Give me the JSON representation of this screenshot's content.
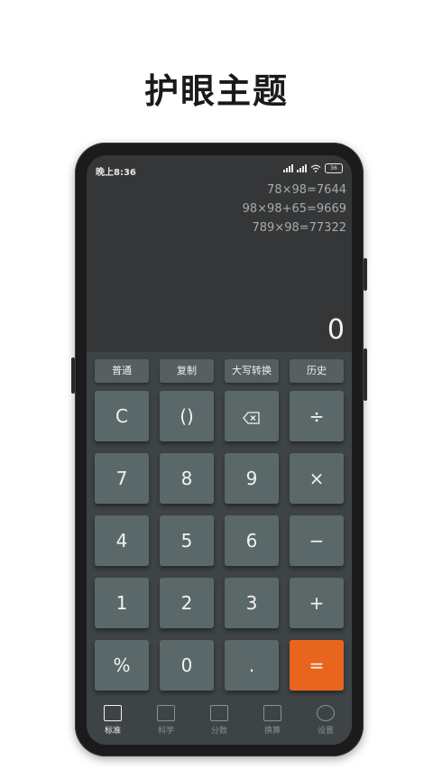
{
  "headline": "护眼主题",
  "status": {
    "time": "晚上8:36",
    "battery": "36"
  },
  "history": [
    "78×98=7644",
    "98×98+65=9669",
    "789×98=77322"
  ],
  "display": {
    "result": "0"
  },
  "function_buttons": [
    "普通",
    "复制",
    "大写转换",
    "历史"
  ],
  "keys": {
    "clear": "C",
    "paren": "()",
    "divide": "÷",
    "seven": "7",
    "eight": "8",
    "nine": "9",
    "multiply": "×",
    "four": "4",
    "five": "5",
    "six": "6",
    "minus": "−",
    "one": "1",
    "two": "2",
    "three": "3",
    "plus": "+",
    "percent": "%",
    "zero": "0",
    "dot": ".",
    "equals": "="
  },
  "nav": [
    "标准",
    "科学",
    "分数",
    "换算",
    "设置"
  ],
  "colors": {
    "accent": "#e8651e",
    "key": "#5b6869",
    "screen": "#353637"
  }
}
